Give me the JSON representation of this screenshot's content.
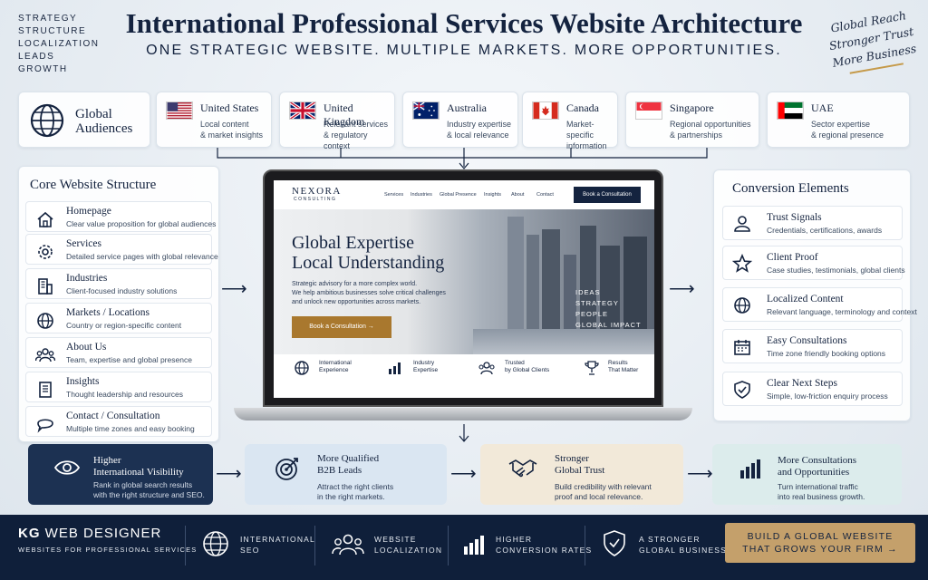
{
  "header": {
    "left_words": [
      "Strategy",
      "Structure",
      "Localization",
      "Leads",
      "Growth"
    ],
    "title": "International Professional Services Website Architecture",
    "subtitle": "ONE STRATEGIC WEBSITE. MULTIPLE MARKETS. MORE OPPORTUNITIES.",
    "handwritten": [
      "Global Reach",
      "Stronger Trust",
      "More Business"
    ]
  },
  "global_audiences": {
    "label_line1": "Global",
    "label_line2": "Audiences"
  },
  "markets": [
    {
      "name": "United States",
      "desc1": "Local content",
      "desc2": "& market insights"
    },
    {
      "name": "United Kingdom",
      "desc1": "Relevant services",
      "desc2": "& regulatory context"
    },
    {
      "name": "Australia",
      "desc1": "Industry expertise",
      "desc2": "& local relevance"
    },
    {
      "name": "Canada",
      "desc1": "Market-specific",
      "desc2": "information"
    },
    {
      "name": "Singapore",
      "desc1": "Regional opportunities",
      "desc2": "& partnerships"
    },
    {
      "name": "UAE",
      "desc1": "Sector expertise",
      "desc2": "& regional presence"
    }
  ],
  "core": {
    "heading": "Core Website Structure",
    "items": [
      {
        "title": "Homepage",
        "desc": "Clear value proposition for global audiences",
        "icon": "home-icon"
      },
      {
        "title": "Services",
        "desc": "Detailed service pages with global relevance",
        "icon": "gear-icon"
      },
      {
        "title": "Industries",
        "desc": "Client-focused industry solutions",
        "icon": "building-icon"
      },
      {
        "title": "Markets / Locations",
        "desc": "Country or region-specific content",
        "icon": "globe-icon"
      },
      {
        "title": "About Us",
        "desc": "Team, expertise and global presence",
        "icon": "team-icon"
      },
      {
        "title": "Insights",
        "desc": "Thought leadership and resources",
        "icon": "document-icon"
      },
      {
        "title": "Contact / Consultation",
        "desc": "Multiple time zones and easy booking",
        "icon": "chat-icon"
      }
    ]
  },
  "conversion": {
    "heading": "Conversion Elements",
    "items": [
      {
        "title": "Trust Signals",
        "desc": "Credentials, certifications, awards",
        "icon": "person-icon"
      },
      {
        "title": "Client Proof",
        "desc": "Case studies, testimonials, global clients",
        "icon": "star-icon"
      },
      {
        "title": "Localized Content",
        "desc": "Relevant language, terminology and context",
        "icon": "globe-icon"
      },
      {
        "title": "Easy Consultations",
        "desc": "Time zone friendly booking options",
        "icon": "calendar-icon"
      },
      {
        "title": "Clear Next Steps",
        "desc": "Simple, low-friction enquiry process",
        "icon": "shield-check-icon"
      }
    ]
  },
  "site": {
    "brand": "NEXORA",
    "brand_sub": "CONSULTING",
    "nav": [
      "Services",
      "Industries",
      "Global Presence",
      "Insights",
      "About",
      "Contact"
    ],
    "nav_button": "Book a Consultation",
    "hero_title1": "Global Expertise",
    "hero_title2": "Local Understanding",
    "hero_text1": "Strategic advisory for a more complex world.",
    "hero_text2": "We help ambitious businesses solve critical challenges",
    "hero_text3": "and unlock new opportunities across markets.",
    "hero_button": "Book a Consultation  →",
    "overlay": [
      "IDEAS",
      "STRATEGY",
      "PEOPLE",
      "GLOBAL IMPACT"
    ],
    "features": [
      {
        "l1": "International",
        "l2": "Experience"
      },
      {
        "l1": "Industry",
        "l2": "Expertise"
      },
      {
        "l1": "Trusted",
        "l2": "by Global Clients"
      },
      {
        "l1": "Results",
        "l2": "That Matter"
      }
    ]
  },
  "outcomes": [
    {
      "t1": "Higher",
      "t2": "International Visibility",
      "d1": "Rank in global search results",
      "d2": "with the right structure and SEO."
    },
    {
      "t1": "More Qualified",
      "t2": "B2B Leads",
      "d1": "Attract the right clients",
      "d2": "in the right markets."
    },
    {
      "t1": "Stronger",
      "t2": "Global Trust",
      "d1": "Build credibility with relevant",
      "d2": "proof and local relevance."
    },
    {
      "t1": "More Consultations",
      "t2": "and Opportunities",
      "d1": "Turn international traffic",
      "d2": "into real business growth."
    }
  ],
  "footer": {
    "brand_kg": "KG",
    "brand_rest": "WEB DESIGNER",
    "brand_sub": "WEBSITES FOR PROFESSIONAL SERVICES",
    "items": [
      {
        "l1": "International",
        "l2": "SEO"
      },
      {
        "l1": "Website",
        "l2": "Localization"
      },
      {
        "l1": "Higher",
        "l2": "Conversion Rates"
      },
      {
        "l1": "A Stronger",
        "l2": "Global Business"
      }
    ],
    "cta1": "BUILD A GLOBAL WEBSITE",
    "cta2": "THAT GROWS YOUR FIRM  →"
  },
  "colors": {
    "navy": "#0f1f3a",
    "gold": "#c4a06b",
    "btn_brown": "#a9782e"
  }
}
